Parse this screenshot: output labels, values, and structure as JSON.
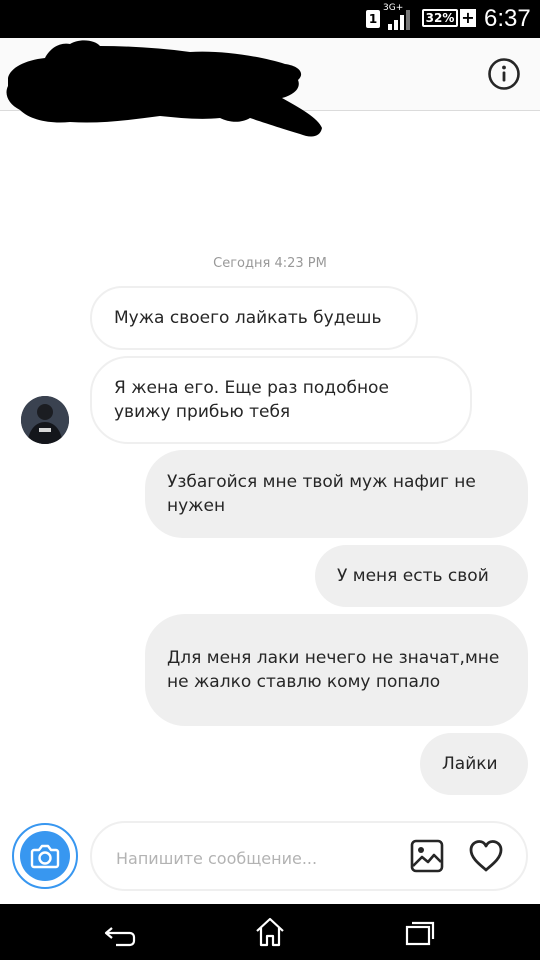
{
  "status_bar": {
    "sim_slot": "1",
    "network": "3G+",
    "battery": "32%",
    "charging": "+",
    "time": "6:37"
  },
  "header": {
    "info_icon": "info-circle-icon"
  },
  "conversation": {
    "timestamp": "Сегодня 4:23 PM",
    "messages": [
      {
        "direction": "incoming",
        "text": "Мужа своего лайкать будешь"
      },
      {
        "direction": "incoming",
        "text": "Я жена его. Еще раз подобное увижу прибью тебя"
      },
      {
        "direction": "outgoing",
        "text": "Узбагойся мне твой муж нафиг не нужен"
      },
      {
        "direction": "outgoing",
        "text": "У меня есть свой"
      },
      {
        "direction": "outgoing",
        "text": "Для меня лаки нечего не значат,мне не жалко ставлю кому попало"
      },
      {
        "direction": "outgoing",
        "text": "Лайки"
      }
    ]
  },
  "composer": {
    "placeholder": "Напишите сообщение...",
    "value": "",
    "camera_icon": "camera-icon",
    "gallery_icon": "image-icon",
    "like_icon": "heart-icon"
  },
  "nav_bar": {
    "back_icon": "back-icon",
    "home_icon": "home-icon",
    "recent_icon": "recent-apps-icon"
  },
  "colors": {
    "accent": "#3897f0",
    "bubble_out": "#efefef",
    "bubble_in_border": "#efefef",
    "text": "#262626",
    "timestamp": "#999999"
  }
}
